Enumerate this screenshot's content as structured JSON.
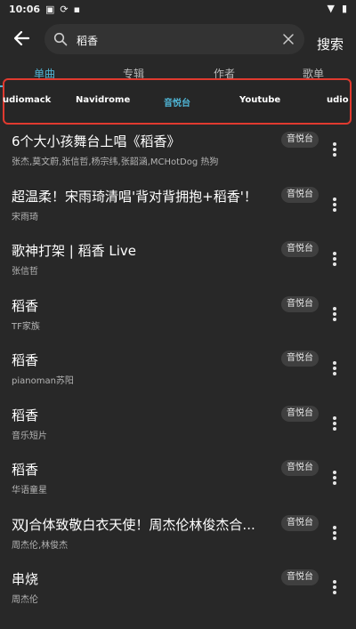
{
  "status": {
    "time": "10:06",
    "icons": [
      "gallery-icon",
      "sync-icon",
      "sd-card-icon",
      "wifi-icon",
      "battery-icon"
    ]
  },
  "search": {
    "query": "稻香",
    "submit_label": "搜索"
  },
  "category_tabs": [
    {
      "label": "单曲",
      "active": true
    },
    {
      "label": "专辑",
      "active": false
    },
    {
      "label": "作者",
      "active": false
    },
    {
      "label": "歌单",
      "active": false
    }
  ],
  "source_tabs": [
    {
      "label": "udiomack",
      "active": false
    },
    {
      "label": "Navidrome",
      "active": false
    },
    {
      "label": "音悦台",
      "active": true
    },
    {
      "label": "Youtube",
      "active": false
    },
    {
      "label": "udio",
      "active": false
    }
  ],
  "songs": [
    {
      "title": "6个大小孩舞台上唱《稻香》",
      "artist": "张杰,莫文蔚,张信哲,杨宗纬,张韶涵,MCHotDog 热狗",
      "source": "音悦台"
    },
    {
      "title": "超温柔！宋雨琦清唱'背对背拥抱+稻香'！",
      "artist": "宋雨琦",
      "source": "音悦台"
    },
    {
      "title": "歌神打架 | 稻香 Live",
      "artist": "张信哲",
      "source": "音悦台"
    },
    {
      "title": "稻香",
      "artist": "TF家族",
      "source": "音悦台"
    },
    {
      "title": "稻香",
      "artist": "pianoman苏阳",
      "source": "音悦台"
    },
    {
      "title": "稻香",
      "artist": "音乐短片",
      "source": "音悦台"
    },
    {
      "title": "稻香",
      "artist": "华语童星",
      "source": "音悦台"
    },
    {
      "title": "双J合体致敬白衣天使！周杰伦林俊杰合...",
      "artist": "周杰伦,林俊杰",
      "source": "音悦台"
    },
    {
      "title": "串烧",
      "artist": "周杰伦",
      "source": "音悦台"
    }
  ],
  "colors": {
    "background": "#282828",
    "accent": "#4fb4d4",
    "highlight_border": "#e03a2f",
    "badge_bg": "#3f3f3f"
  }
}
